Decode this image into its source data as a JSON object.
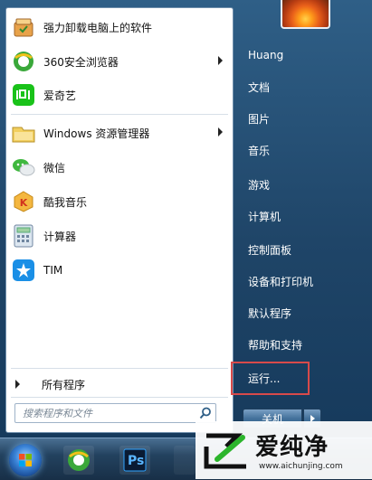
{
  "left_pane": {
    "items": [
      {
        "label": "强力卸载电脑上的软件",
        "has_submenu": false,
        "icon": "uninstall-icon"
      },
      {
        "label": "360安全浏览器",
        "has_submenu": true,
        "icon": "browser-360-icon"
      },
      {
        "label": "爱奇艺",
        "has_submenu": false,
        "icon": "iqiyi-icon"
      },
      {
        "label": "Windows 资源管理器",
        "has_submenu": true,
        "icon": "explorer-icon"
      },
      {
        "label": "微信",
        "has_submenu": false,
        "icon": "wechat-icon"
      },
      {
        "label": "酷我音乐",
        "has_submenu": false,
        "icon": "kuwo-music-icon"
      },
      {
        "label": "计算器",
        "has_submenu": false,
        "icon": "calculator-icon"
      },
      {
        "label": "TIM",
        "has_submenu": false,
        "icon": "tim-icon"
      }
    ],
    "all_programs": "所有程序",
    "search_placeholder": "搜索程序和文件"
  },
  "right_pane": {
    "items": [
      "Huang",
      "文档",
      "图片",
      "音乐",
      "游戏",
      "计算机",
      "控制面板",
      "设备和打印机",
      "默认程序",
      "帮助和支持",
      "运行..."
    ],
    "shutdown": "关机"
  },
  "watermark": {
    "brand": "爱纯净",
    "url": "www.aichunjing.com"
  },
  "taskbar": {
    "photoshop_label": "Ps"
  },
  "colors": {
    "highlight_border": "#d84a4a",
    "menu_blue": "#1f4568"
  }
}
